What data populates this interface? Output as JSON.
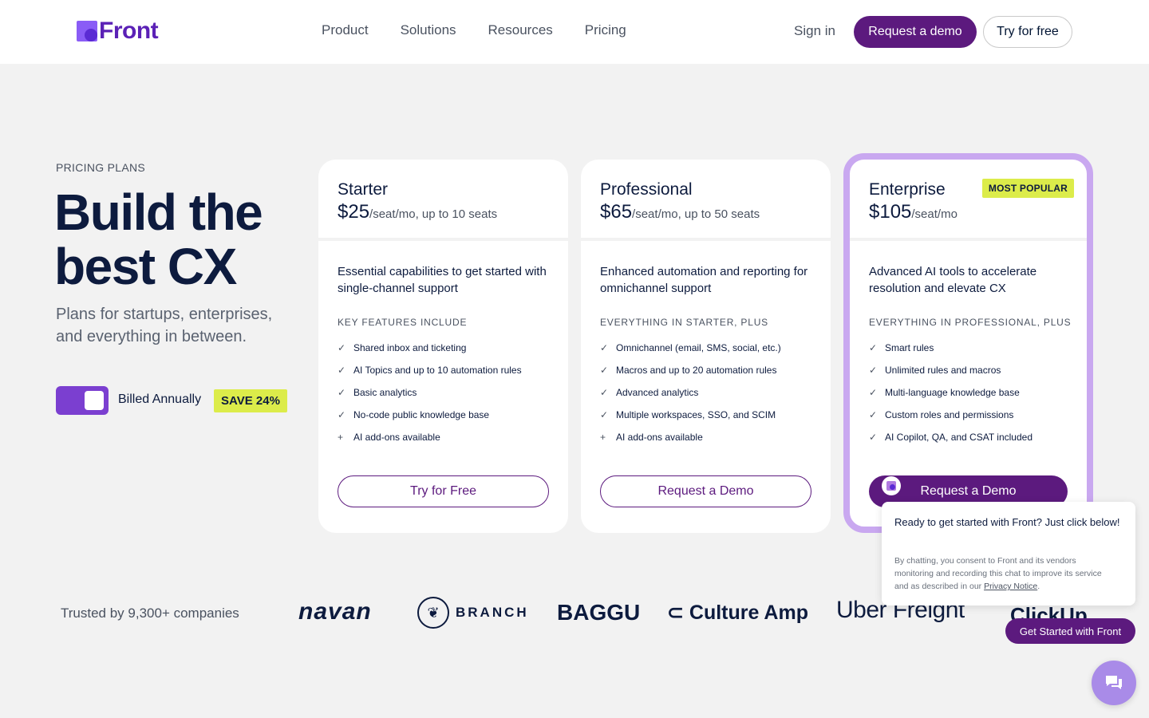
{
  "nav": {
    "logo_text": "Front",
    "links": [
      "Product",
      "Solutions",
      "Resources",
      "Pricing"
    ],
    "sign_in": "Sign in",
    "request_demo": "Request a demo",
    "try_free": "Try for free"
  },
  "hero": {
    "eyebrow": "PRICING PLANS",
    "title": "Build the best CX",
    "subtitle": "Plans for startups, enterprises, and everything in between.",
    "billing_label": "Billed Annually",
    "billing_annual": true,
    "save_badge": "SAVE 24%"
  },
  "plans": [
    {
      "name": "Starter",
      "price": "$25",
      "price_suffix": "/seat/mo, up to 10 seats",
      "description": "Essential capabilities to get started with single-channel support",
      "features_heading": "KEY FEATURES INCLUDE",
      "features": [
        {
          "icon": "check-icon",
          "text": "Shared inbox and ticketing"
        },
        {
          "icon": "check-icon",
          "text": "AI Topics and up to 10 automation rules"
        },
        {
          "icon": "check-icon",
          "text": "Basic analytics"
        },
        {
          "icon": "check-icon",
          "text": "No-code public knowledge base"
        },
        {
          "icon": "plus-icon",
          "text": "AI add-ons available"
        }
      ],
      "cta": "Try for Free"
    },
    {
      "name": "Professional",
      "price": "$65",
      "price_suffix": "/seat/mo, up to 50 seats",
      "description": "Enhanced automation and reporting for omnichannel support",
      "features_heading": "EVERYTHING IN STARTER, PLUS",
      "features": [
        {
          "icon": "check-icon",
          "text": "Omnichannel (email, SMS, social, etc.)"
        },
        {
          "icon": "check-icon",
          "text": "Macros and up to 20 automation rules"
        },
        {
          "icon": "check-icon",
          "text": "Advanced analytics"
        },
        {
          "icon": "check-icon",
          "text": "Multiple workspaces, SSO, and SCIM"
        },
        {
          "icon": "plus-icon",
          "text": "AI add-ons available"
        }
      ],
      "cta": "Request a Demo"
    },
    {
      "name": "Enterprise",
      "price": "$105",
      "price_suffix": "/seat/mo",
      "badge": "MOST POPULAR",
      "description": "Advanced AI tools to accelerate resolution and elevate CX",
      "features_heading": "EVERYTHING IN PROFESSIONAL, PLUS",
      "features": [
        {
          "icon": "check-icon",
          "text": "Smart rules"
        },
        {
          "icon": "check-icon",
          "text": "Unlimited rules and macros"
        },
        {
          "icon": "check-icon",
          "text": "Multi-language knowledge base"
        },
        {
          "icon": "check-icon",
          "text": "Custom roles and permissions"
        },
        {
          "icon": "check-icon",
          "text": "AI Copilot, QA, and CSAT included"
        }
      ],
      "cta": "Request a Demo"
    }
  ],
  "trusted": {
    "label": "Trusted by 9,300+ companies",
    "logos": {
      "navan": "navan",
      "branch": "BRANCH",
      "baggu": "BAGGU",
      "culture_amp": "Culture Amp",
      "uber_freight": "Uber Freight",
      "clickup": "ClickUp"
    }
  },
  "chat": {
    "message": "Ready to get started with Front? Just click below!",
    "consent_prefix": "By chatting, you consent to Front and its vendors monitoring and recording this chat to improve its service and as described in our ",
    "consent_link": "Privacy Notice",
    "consent_suffix": ".",
    "cta": "Get Started with Front"
  },
  "colors": {
    "brand_purple": "#5c1a7e",
    "accent_lime": "#dcec4a",
    "popular_border": "#c9a8f0",
    "toggle_purple": "#7b3fd0"
  }
}
